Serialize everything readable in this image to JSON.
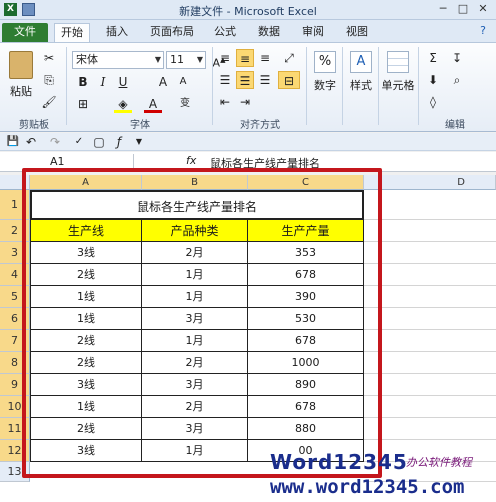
{
  "window": {
    "title": "新建文件 - Microsoft Excel"
  },
  "tabs": [
    "文件",
    "开始",
    "插入",
    "页面布局",
    "公式",
    "数据",
    "审阅",
    "视图"
  ],
  "ribbon": {
    "clipboard": {
      "paste": "粘贴",
      "label": "剪贴板"
    },
    "font": {
      "name": "宋体",
      "size": "11",
      "label": "字体"
    },
    "alignment": {
      "label": "对齐方式"
    },
    "number": {
      "button": "数字",
      "symbol": "%"
    },
    "styles": {
      "button": "样式"
    },
    "cells": {
      "button": "单元格"
    },
    "editing": {
      "label": "编辑"
    }
  },
  "formula_bar": {
    "name_box": "A1",
    "fx": "fx",
    "content": "鼠标各生产线产量排名"
  },
  "sheet": {
    "columns": [
      "A",
      "B",
      "C",
      "D"
    ],
    "rows": [
      "1",
      "2",
      "3",
      "4",
      "5",
      "6",
      "7",
      "8",
      "9",
      "10",
      "11",
      "12",
      "13"
    ],
    "title": "鼠标各生产线产量排名",
    "headers": [
      "生产线",
      "产品种类",
      "生产产量"
    ],
    "data": [
      [
        "3线",
        "2月",
        "353"
      ],
      [
        "2线",
        "1月",
        "678"
      ],
      [
        "1线",
        "1月",
        "390"
      ],
      [
        "1线",
        "3月",
        "530"
      ],
      [
        "2线",
        "1月",
        "678"
      ],
      [
        "2线",
        "2月",
        "1000"
      ],
      [
        "3线",
        "3月",
        "890"
      ],
      [
        "1线",
        "2月",
        "678"
      ],
      [
        "2线",
        "3月",
        "880"
      ],
      [
        "3线",
        "1月",
        "00"
      ]
    ]
  },
  "watermark": {
    "brand": "Word12345",
    "tag": "办公软件教程",
    "url": "www.word12345.com"
  },
  "colors": {
    "header_fill": "#ffff00",
    "frame": "#c4161c",
    "file_tab": "#2e7d32"
  }
}
